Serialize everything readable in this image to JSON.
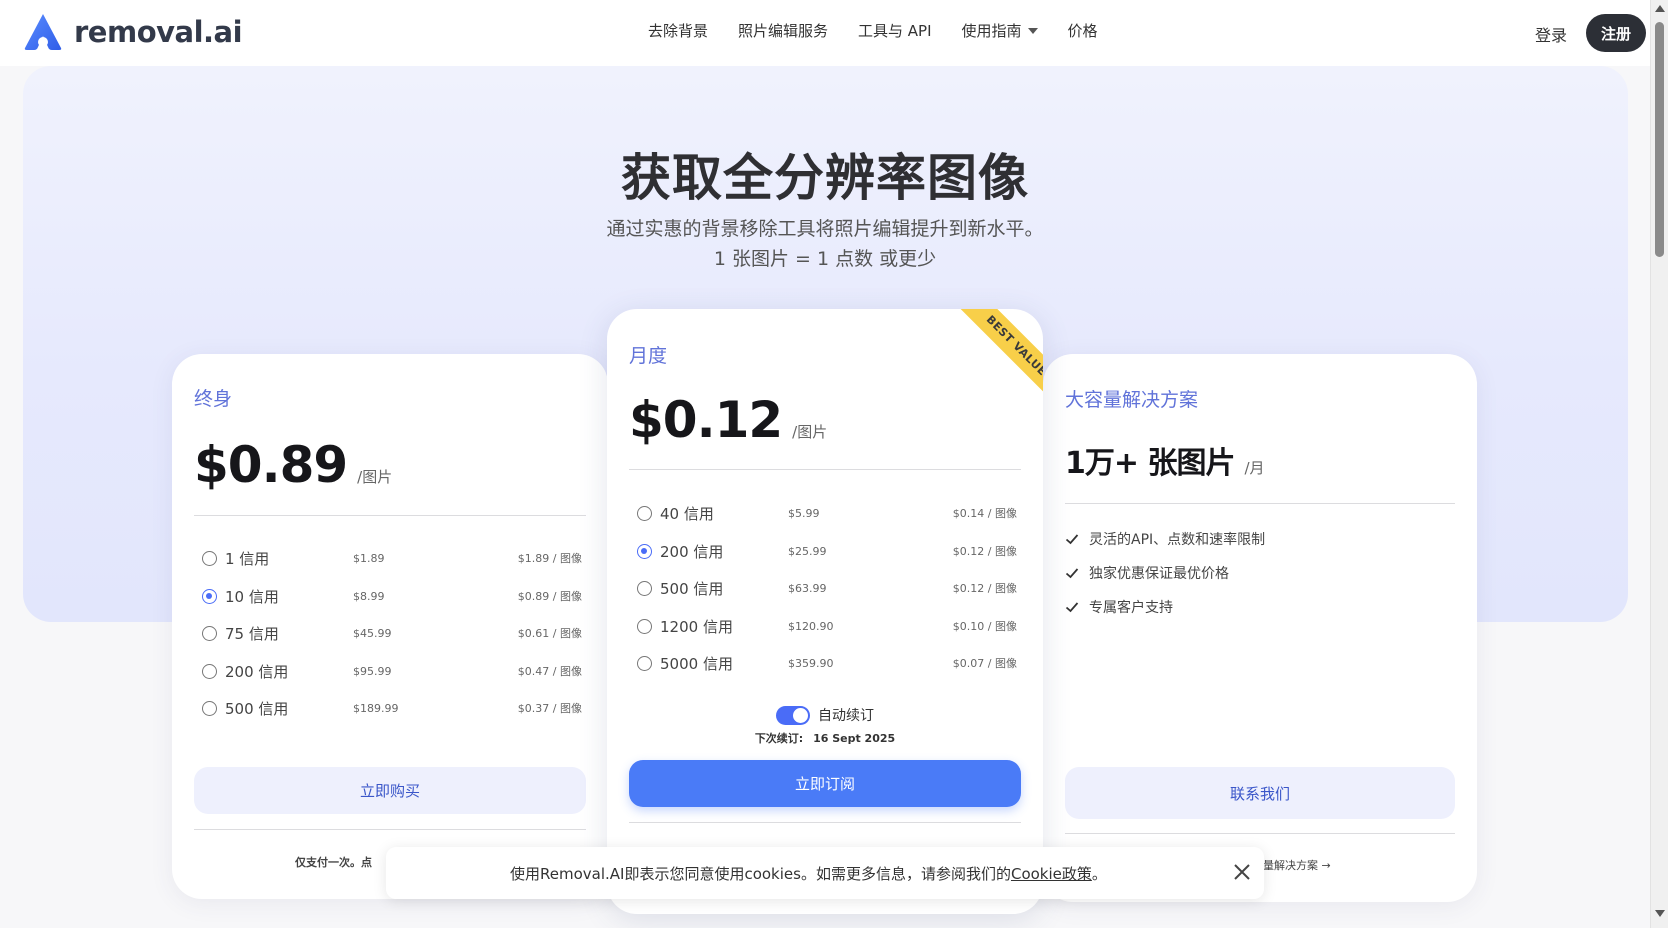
{
  "brand": {
    "name": "removal.ai",
    "color": "#4a6cf7"
  },
  "nav": {
    "items": [
      "去除背景",
      "照片编辑服务",
      "工具与 API",
      "使用指南",
      "价格"
    ],
    "login": "登录",
    "signup": "注册"
  },
  "hero": {
    "title": "获取全分辨率图像",
    "subtitle": "通过实惠的背景移除工具将照片编辑提升到新水平。",
    "subtitle2": "1 张图片 = 1 点数 或更少"
  },
  "lifetime": {
    "name": "终身",
    "price": "$0.89",
    "per": "/图片",
    "options": [
      {
        "label": "1 信用",
        "price": "$1.89",
        "unit": "$1.89 / 图像",
        "selected": false
      },
      {
        "label": "10 信用",
        "price": "$8.99",
        "unit": "$0.89 / 图像",
        "selected": true
      },
      {
        "label": "75 信用",
        "price": "$45.99",
        "unit": "$0.61 / 图像",
        "selected": false
      },
      {
        "label": "200 信用",
        "price": "$95.99",
        "unit": "$0.47 / 图像",
        "selected": false
      },
      {
        "label": "500 信用",
        "price": "$189.99",
        "unit": "$0.37 / 图像",
        "selected": false
      }
    ],
    "button": "立即购买",
    "footnote": "仅支付一次。点"
  },
  "monthly": {
    "name": "月度",
    "badge": "BEST VALUE!",
    "price": "$0.12",
    "per": "/图片",
    "options": [
      {
        "label": "40 信用",
        "price": "$5.99",
        "unit": "$0.14 / 图像",
        "selected": false
      },
      {
        "label": "200 信用",
        "price": "$25.99",
        "unit": "$0.12 / 图像",
        "selected": true
      },
      {
        "label": "500 信用",
        "price": "$63.99",
        "unit": "$0.12 / 图像",
        "selected": false
      },
      {
        "label": "1200 信用",
        "price": "$120.90",
        "unit": "$0.10 / 图像",
        "selected": false
      },
      {
        "label": "5000 信用",
        "price": "$359.90",
        "unit": "$0.07 / 图像",
        "selected": false
      }
    ],
    "auto_renew": "自动续订",
    "auto_renew_on": true,
    "next_renew_label": "下次续订:",
    "next_renew_date": "16 Sept 2025",
    "button": "立即订阅"
  },
  "volume": {
    "name": "大容量解决方案",
    "price": "1万+ 张图片",
    "per": "/月",
    "features": [
      "灵活的API、点数和速率限制",
      "独家优惠保证最优价格",
      "专属客户支持"
    ],
    "button": "联系我们",
    "footnote": "量解决方案 →"
  },
  "cookie": {
    "text": "使用Removal.AI即表示您同意使用cookies。如需更多信息，请参阅我们的",
    "link": "Cookie政策",
    "end": "。"
  },
  "colors": {
    "accent": "#4a7bf7",
    "plan_name": "#6173d9",
    "ribbon": "#f8cf49",
    "signup_bg": "#2c2f36"
  }
}
